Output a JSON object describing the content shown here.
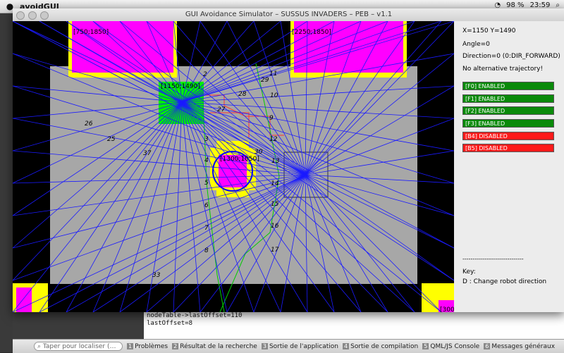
{
  "menubar": {
    "app": "avoidGUI",
    "clock": "23:59",
    "battery": "98 %"
  },
  "window": {
    "title": "GUI Avoidance Simulator – SUSSUS INVADERS – PEB – v1.1"
  },
  "canvas": {
    "blocks": {
      "tl": "[750;1850]",
      "tr": "[2250;1850]",
      "robot": "[1150;1490]",
      "obstacle": "[1300;1050]",
      "br": "[300"
    },
    "node_labels": [
      "2",
      "29",
      "11",
      "28",
      "10",
      "27",
      "9",
      "26",
      "25",
      "37",
      "12",
      "13",
      "14",
      "15",
      "16",
      "17",
      "3",
      "4",
      "5",
      "6",
      "7",
      "8",
      "33",
      "30"
    ]
  },
  "panel": {
    "pos": "X=1150 Y=1490",
    "angle": "Angle=0",
    "direction": "Direction=0 (0:DIR_FORWARD)",
    "alt": "No alternative trajectory!",
    "statuses": [
      {
        "label": "[F0] ENABLED",
        "state": "enabled"
      },
      {
        "label": "[F1] ENABLED",
        "state": "enabled"
      },
      {
        "label": "[F2] ENABLED",
        "state": "enabled"
      },
      {
        "label": "[F3] ENABLED",
        "state": "enabled"
      },
      {
        "label": "[B4] DISABLED",
        "state": "disabled"
      },
      {
        "label": "[B5] DISABLED",
        "state": "disabled"
      }
    ],
    "separator": "------------------------------",
    "key": "Key:",
    "key_d": "D : Change robot direction"
  },
  "console": {
    "l1": "nodeTable->lastOffset=110",
    "l2": "lastOffset=8"
  },
  "statusbar": {
    "search_placeholder": "Taper pour localiser (…",
    "tabs": [
      {
        "n": "1",
        "label": "Problèmes"
      },
      {
        "n": "2",
        "label": "Résultat de la recherche"
      },
      {
        "n": "3",
        "label": "Sortie de l'application"
      },
      {
        "n": "4",
        "label": "Sortie de compilation"
      },
      {
        "n": "5",
        "label": "QML/JS Console"
      },
      {
        "n": "6",
        "label": "Messages généraux"
      }
    ]
  }
}
